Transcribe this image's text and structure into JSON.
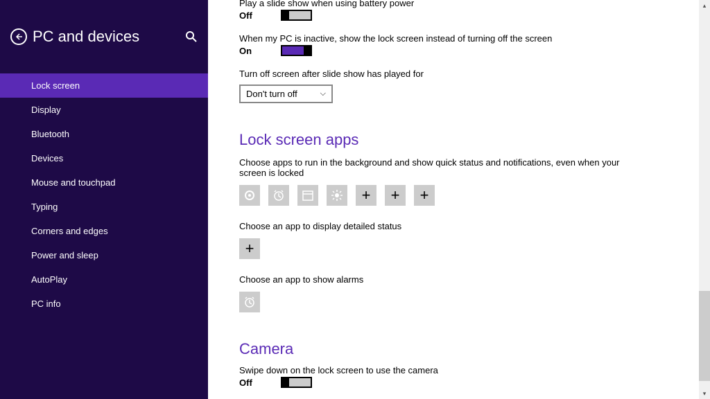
{
  "sidebar": {
    "title": "PC and devices",
    "items": [
      {
        "label": "Lock screen",
        "active": true
      },
      {
        "label": "Display"
      },
      {
        "label": "Bluetooth"
      },
      {
        "label": "Devices"
      },
      {
        "label": "Mouse and touchpad"
      },
      {
        "label": "Typing"
      },
      {
        "label": "Corners and edges"
      },
      {
        "label": "Power and sleep"
      },
      {
        "label": "AutoPlay"
      },
      {
        "label": "PC info"
      }
    ]
  },
  "content": {
    "battery_slideshow": {
      "label": "Play a slide show when using battery power",
      "state": "Off"
    },
    "inactive_lockscreen": {
      "label": "When my PC is inactive, show the lock screen instead of turning off the screen",
      "state": "On"
    },
    "turn_off_after": {
      "label": "Turn off screen after slide show has played for",
      "value": "Don't turn off"
    },
    "lock_apps": {
      "title": "Lock screen apps",
      "desc": "Choose apps to run in the background and show quick status and notifications, even when your screen is locked",
      "detailed_label": "Choose an app to display detailed status",
      "alarms_label": "Choose an app to show alarms"
    },
    "camera": {
      "title": "Camera",
      "desc": "Swipe down on the lock screen to use the camera",
      "state": "Off"
    }
  }
}
